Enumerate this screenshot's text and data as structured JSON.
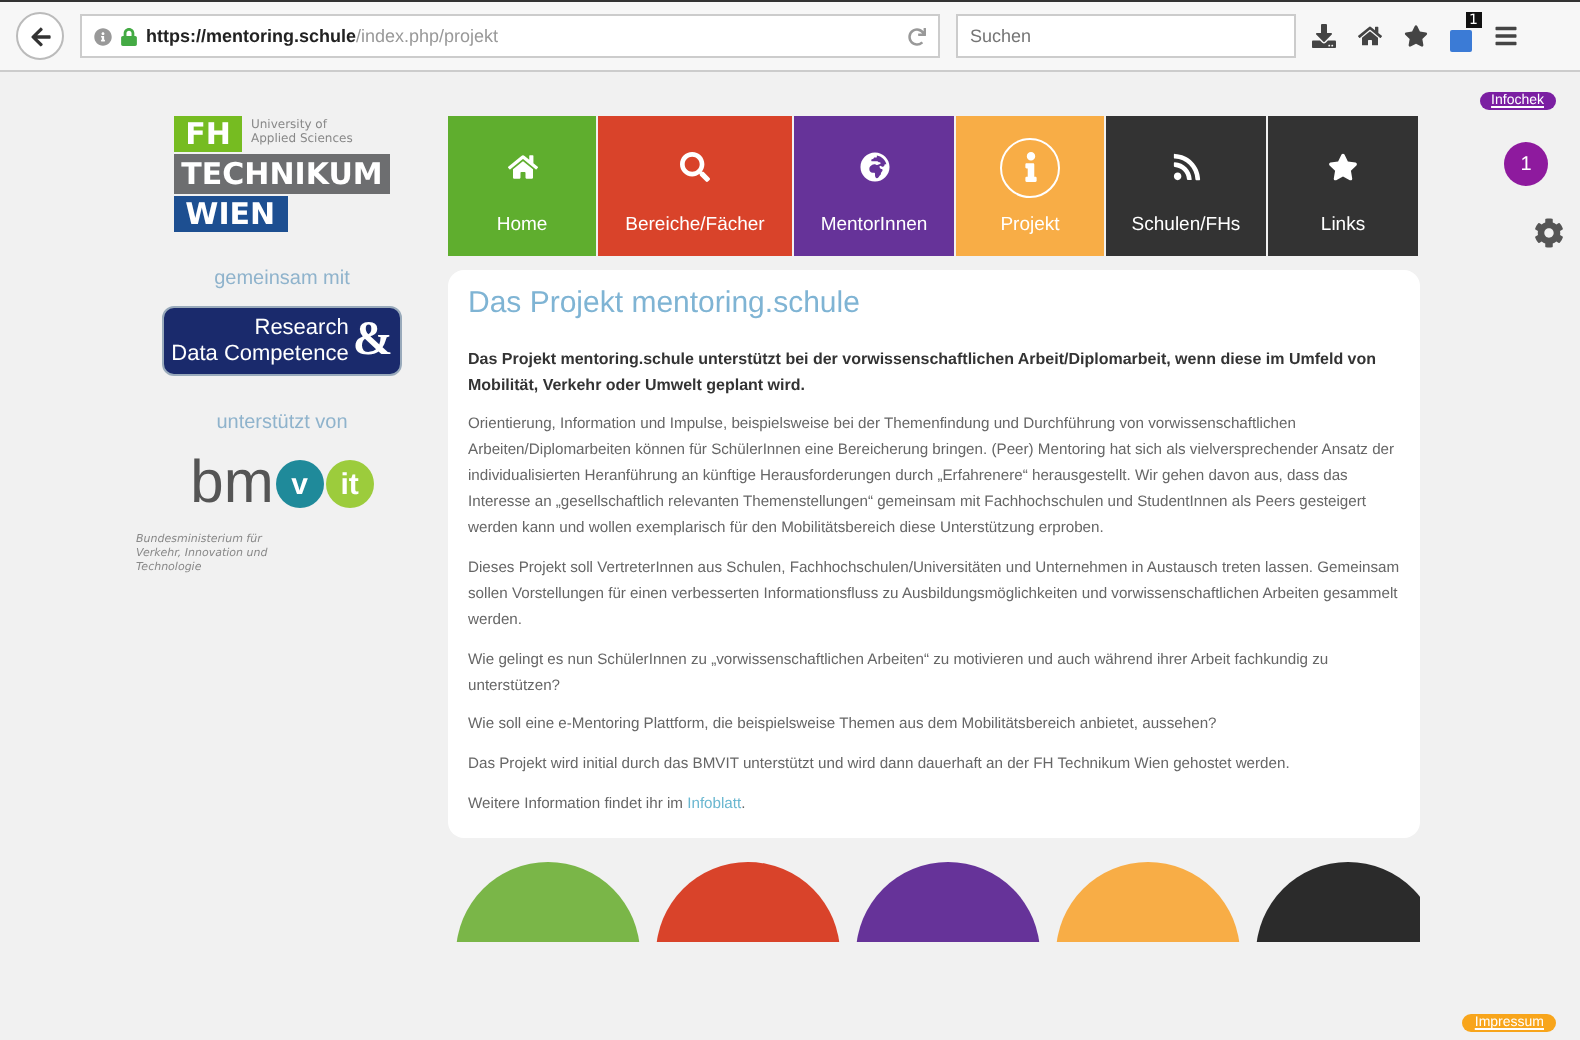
{
  "browser": {
    "url_host": "https://mentoring.schule",
    "url_path": "/index.php/projekt",
    "search": {
      "placeholder": "Suchen"
    },
    "badge": "1"
  },
  "sidebar": {
    "logo": {
      "fh": "FH",
      "tagline": "University of Applied Sciences",
      "technikum": "TECHNIKUM",
      "wien": "WIEN"
    },
    "together_label": "gemeinsam mit",
    "partner": {
      "line1": "Research",
      "line2": "Data Competence",
      "amp": "&"
    },
    "supported_label": "unterstützt von",
    "sponsor": {
      "prefix": "bm",
      "v": "v",
      "it": "it",
      "caption": "Bundesministerium für Verkehr, Innovation und Technologie"
    }
  },
  "nav": [
    {
      "label": "Home",
      "color": "#5fae2e",
      "selected": false
    },
    {
      "label": "Bereiche/Fächer",
      "color": "#d9432a",
      "selected": false
    },
    {
      "label": "MentorInnen",
      "color": "#663399",
      "selected": false
    },
    {
      "label": "Projekt",
      "color": "#f8ad46",
      "selected": true
    },
    {
      "label": "Schulen/FHs",
      "color": "#333333",
      "selected": false
    },
    {
      "label": "Links",
      "color": "#333333",
      "selected": false
    }
  ],
  "side_tools": {
    "infocheck": "Infochek",
    "count": "1",
    "impressum": "Impressum"
  },
  "article": {
    "title": "Das Projekt mentoring.schule",
    "lead": "Das Projekt mentoring.schule unterstützt bei der vorwissenschaftlichen Arbeit/Diplomarbeit, wenn diese im Umfeld von Mobilität, Verkehr oder Umwelt geplant wird.",
    "paragraphs": [
      "Orientierung, Information und Impulse, beispielsweise bei der Themenfindung und Durchführung von vorwissenschaftlichen Arbeiten/Diplomarbeiten können für SchülerInnen eine Bereicherung bringen. (Peer) Mentoring hat sich als vielversprechender Ansatz der individualisierten Heranführung an künftige Herausforderungen durch „Erfahrenere“ herausgestellt. Wir gehen davon aus, dass das Interesse an „gesellschaftlich relevanten Themenstellungen“ gemeinsam mit Fachhochschulen und StudentInnen als Peers gesteigert werden kann und wollen exemplarisch für den Mobilitätsbereich diese Unterstützung erproben.",
      "Dieses Projekt soll VertreterInnen aus Schulen, Fachhochschulen/Universitäten und Unternehmen in Austausch treten lassen. Gemeinsam sollen Vorstellungen für einen verbesserten Informationsfluss zu Ausbildungsmöglichkeiten und vorwissenschaftlichen Arbeiten gesammelt werden.",
      "Wie gelingt es nun SchülerInnen zu „vorwissenschaftlichen Arbeiten“ zu motivieren und auch während ihrer Arbeit fachkundig zu unterstützen?",
      "Wie soll eine e-Mentoring Plattform, die beispielsweise Themen aus dem Mobilitätsbereich anbietet, aussehen?",
      "Das Projekt wird initial durch das BMVIT unterstützt und wird dann dauerhaft an der FH Technikum Wien gehostet werden."
    ],
    "more": {
      "text": "Weitere Information findet ihr im",
      "link": "Infoblatt",
      "end": "."
    }
  },
  "bottom_tiles": [
    {
      "color": "#7ab648"
    },
    {
      "color": "#d9432a"
    },
    {
      "color": "#663399"
    },
    {
      "color": "#f8ad46"
    },
    {
      "color": "#2b2b2b"
    }
  ]
}
